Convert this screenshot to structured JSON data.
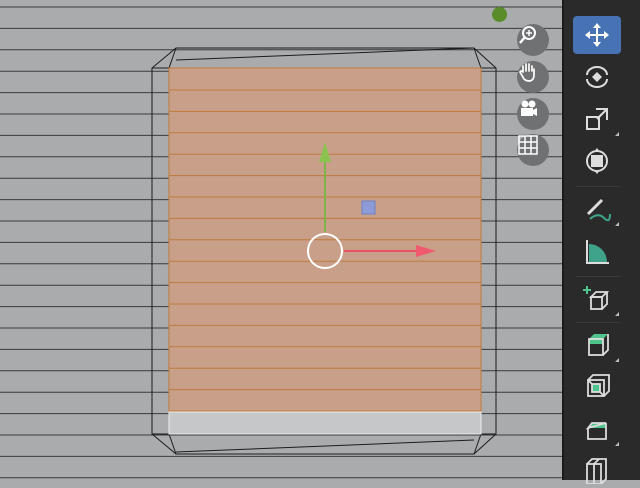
{
  "viewport": {
    "background": "#a9abad",
    "face_fill": "#c8a08a",
    "edge_color": "#c07a3a",
    "status_dot_color": "#5a8c2a"
  },
  "navigation_gizmo": {
    "buttons": [
      {
        "name": "zoom",
        "icon": "zoom-icon"
      },
      {
        "name": "pan",
        "icon": "hand-icon"
      },
      {
        "name": "camera",
        "icon": "camera-icon"
      },
      {
        "name": "ortho",
        "icon": "grid-icon"
      }
    ]
  },
  "toolbar": {
    "accent": "#4772b3",
    "active_tool": "move",
    "tools": [
      {
        "name": "move",
        "icon": "move-icon"
      },
      {
        "name": "rotate",
        "icon": "rotate-icon"
      },
      {
        "name": "scale",
        "icon": "scale-icon"
      },
      {
        "name": "transform",
        "icon": "transform-icon"
      },
      {
        "name": "annotate",
        "icon": "annotate-icon"
      },
      {
        "name": "measure",
        "icon": "measure-icon"
      },
      {
        "name": "add-cube",
        "icon": "add-cube-icon"
      },
      {
        "name": "extrude",
        "icon": "extrude-icon"
      },
      {
        "name": "inset",
        "icon": "inset-icon"
      },
      {
        "name": "bevel",
        "icon": "bevel-icon"
      },
      {
        "name": "loop-cut",
        "icon": "loop-cut-icon"
      }
    ]
  }
}
